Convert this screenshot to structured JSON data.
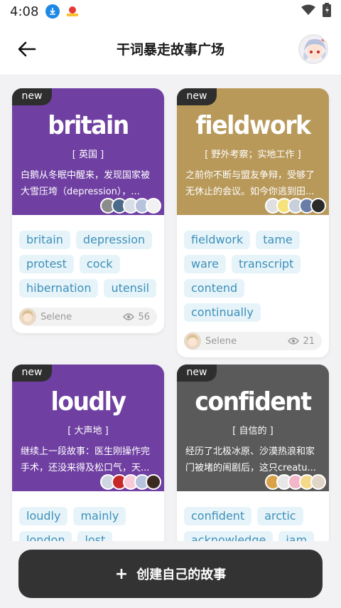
{
  "status_bar": {
    "time": "4:08"
  },
  "app_bar": {
    "title": "干词暴走故事广场"
  },
  "cards": [
    {
      "badge": "new",
      "word": "britain",
      "meaning": "[ 英国 ]",
      "story": "白鹅从冬眠中醒来，发现国家被大雪压垮（depression），...",
      "color": "#6f3fa2",
      "tags": [
        "britain",
        "depression",
        "protest",
        "cock",
        "hibernation",
        "utensil"
      ],
      "author": "Selene",
      "views": "56"
    },
    {
      "badge": "new",
      "word": "fieldwork",
      "meaning": "[ 野外考察；实地工作 ]",
      "story": "之前你不断与盟友争辩，受够了无休止的会议。如今你逃到田...",
      "color": "#b8995a",
      "tags": [
        "fieldwork",
        "tame",
        "ware",
        "transcript",
        "contend",
        "continually"
      ],
      "author": "Selene",
      "views": "21"
    },
    {
      "badge": "new",
      "word": "loudly",
      "meaning": "[ 大声地 ]",
      "story": "继续上一段故事：医生刚操作完手术，还没来得及松口气，天...",
      "color": "#6f3fa2",
      "tags": [
        "loudly",
        "mainly",
        "london",
        "lost"
      ]
    },
    {
      "badge": "new",
      "word": "confident",
      "meaning": "[ 自信的 ]",
      "story": "经历了北极冰原、沙漠热浪和家门被堵的闹剧后，这只creatu...",
      "color": "#5a5a5a",
      "tags": [
        "confident",
        "arctic",
        "acknowledge",
        "jam"
      ]
    }
  ],
  "create_button": {
    "plus": "+",
    "label": "创建自己的故事"
  },
  "colors": {
    "tag_bg": "#e6f4fa",
    "tag_text": "#3e8fb8",
    "button_bg": "#333333"
  }
}
